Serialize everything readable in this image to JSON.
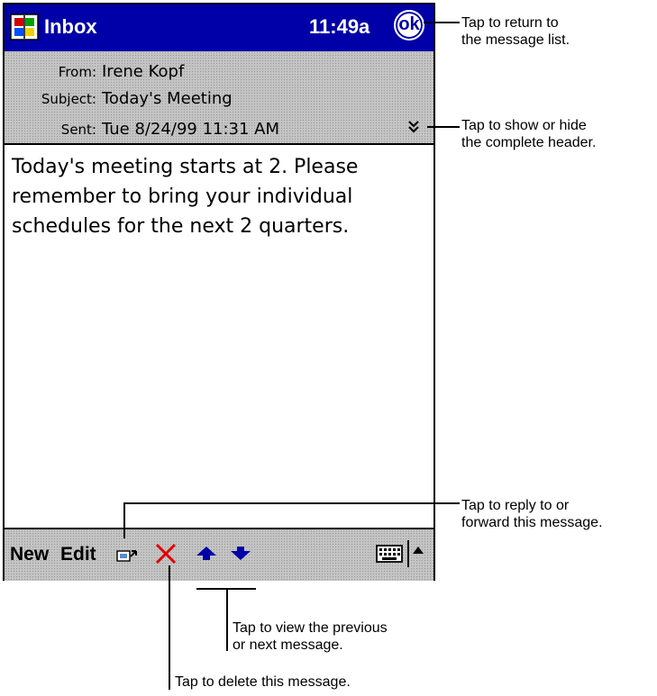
{
  "titlebar": {
    "title": "Inbox",
    "time": "11:49a",
    "ok_label": "ok",
    "app_icon": "windows-flag-icon",
    "bg_color": "#0000a8"
  },
  "header": {
    "from_label": "From:",
    "from_value": "Irene Kopf",
    "subject_label": "Subject:",
    "subject_value": "Today's Meeting",
    "sent_label": "Sent:",
    "sent_value": "Tue 8/24/99 11:31 AM",
    "expand_icon": "double-chevron-down-icon"
  },
  "message": {
    "lines": [
      "Today's meeting starts at 2. Please",
      "remember to bring your individual",
      "schedules for the next 2 quarters."
    ]
  },
  "toolbar": {
    "new_label": "New",
    "edit_label": "Edit",
    "reply_icon": "reply-forward-icon",
    "delete_icon": "delete-x-icon",
    "prev_icon": "up-arrow-icon",
    "next_icon": "down-arrow-icon",
    "keyboard_icon": "keyboard-icon",
    "sip_icon": "input-panel-arrow-icon"
  },
  "callouts": {
    "ok": [
      "Tap to return to",
      "the message list."
    ],
    "header": [
      "Tap to show or hide",
      "the complete header."
    ],
    "reply": [
      "Tap to reply to or",
      "forward this message."
    ],
    "prevnext": [
      "Tap to view the previous",
      "or next message."
    ],
    "delete": "Tap to delete this message."
  }
}
